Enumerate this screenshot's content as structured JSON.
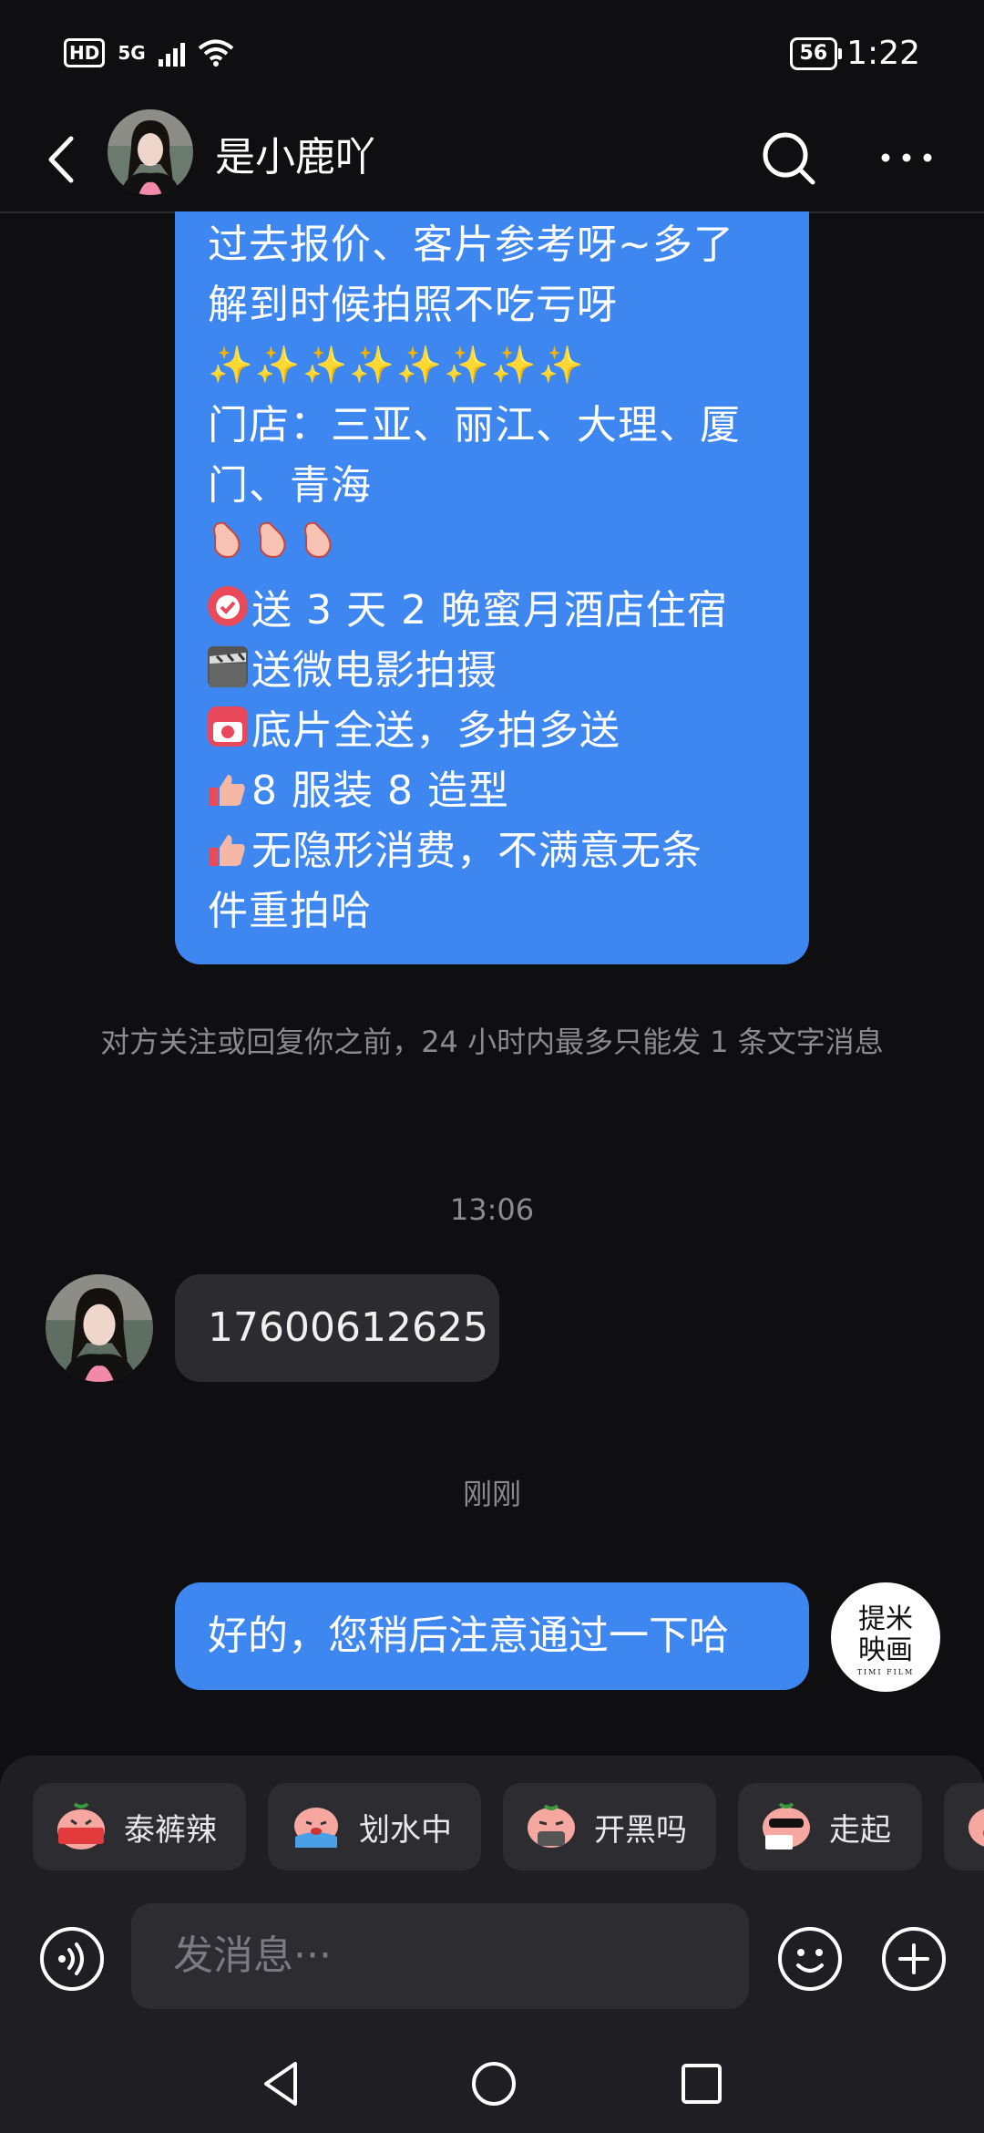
{
  "status_bar": {
    "hd": "HD",
    "network": "5G",
    "battery": "56",
    "time": "1:22"
  },
  "header": {
    "contact_name": "是小鹿吖",
    "icons": [
      "back-icon",
      "search-icon",
      "more-icon"
    ]
  },
  "messages": {
    "promo_lines": [
      "过去报价、客片参考呀~多了",
      "解到时候拍照不吃亏呀",
      "✨✨✨✨✨✨✨✨",
      "门店：三亚、丽江、大理、厦",
      "门、青海",
      "👏👏👏",
      "送 3 天 2 晚蜜月酒店住宿",
      "送微电影拍摄",
      "底片全送，多拍多送",
      "8 服装 8 造型",
      "无隐形消费，不满意无条",
      "件重拍哈"
    ],
    "system_note": "对方关注或回复你之前，24 小时内最多只能发 1 条文字消息",
    "time_1": "13:06",
    "incoming_text": "17600612625",
    "time_2": "刚刚",
    "outgoing_text": "好的，您稍后注意通过一下哈",
    "my_avatar": {
      "line1": "提米",
      "line2": "映画",
      "sub": "TIMI FILM"
    }
  },
  "quick_stickers": [
    {
      "label": "泰裤辣",
      "badge": "泰裤辣"
    },
    {
      "label": "划水中"
    },
    {
      "label": "开黑吗"
    },
    {
      "label": "走起",
      "badge": "走起"
    }
  ],
  "composer": {
    "placeholder": "发消息···"
  },
  "colors": {
    "bubble_out": "#3e87f0",
    "bubble_in": "#2c2c30",
    "background": "#0f0f11"
  }
}
